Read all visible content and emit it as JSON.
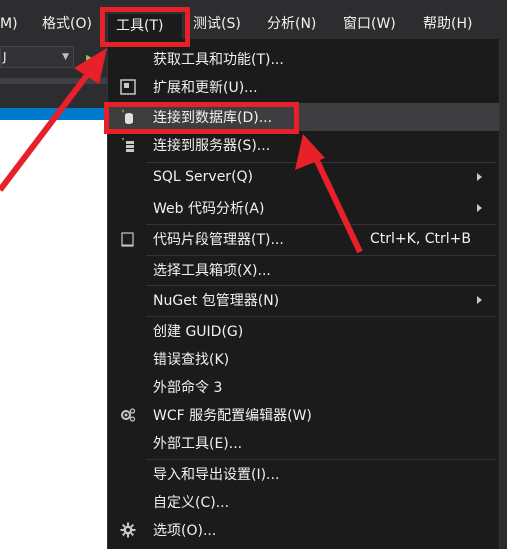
{
  "menubar": {
    "items": [
      {
        "label": "M)"
      },
      {
        "label": "格式(O)"
      },
      {
        "label": "工具(T)"
      },
      {
        "label": "测试(S)"
      },
      {
        "label": "分析(N)"
      },
      {
        "label": "窗口(W)"
      },
      {
        "label": "帮助(H)"
      }
    ]
  },
  "toolbar": {
    "config_value": "J",
    "start_icon": "play-icon"
  },
  "tools_menu": {
    "items": [
      {
        "label": "获取工具和功能(T)...",
        "icon": "none"
      },
      {
        "label": "扩展和更新(U)...",
        "icon": "extensions-icon"
      },
      {
        "label": "连接到数据库(D)...",
        "icon": "database-connect-icon"
      },
      {
        "label": "连接到服务器(S)...",
        "icon": "server-connect-icon"
      },
      {
        "label": "SQL Server(Q)",
        "icon": "none",
        "submenu": true
      },
      {
        "label": "Web 代码分析(A)",
        "icon": "none",
        "submenu": true
      },
      {
        "label": "代码片段管理器(T)...",
        "shortcut": "Ctrl+K, Ctrl+B",
        "icon": "snippet-icon"
      },
      {
        "label": "选择工具箱项(X)...",
        "icon": "none"
      },
      {
        "label": "NuGet 包管理器(N)",
        "icon": "none",
        "submenu": true
      },
      {
        "label": "创建 GUID(G)",
        "icon": "none"
      },
      {
        "label": "错误查找(K)",
        "icon": "none"
      },
      {
        "label": "外部命令 3",
        "icon": "none"
      },
      {
        "label": "WCF 服务配置编辑器(W)",
        "icon": "wcf-config-icon"
      },
      {
        "label": "外部工具(E)...",
        "icon": "none"
      },
      {
        "label": "导入和导出设置(I)...",
        "icon": "none"
      },
      {
        "label": "自定义(C)...",
        "icon": "none"
      },
      {
        "label": "选项(O)...",
        "icon": "gear-icon"
      }
    ]
  },
  "colors": {
    "background": "#2d2d30",
    "menu_background": "#1b1b1c",
    "hover": "#3e3e40",
    "highlight_red": "#e8202a",
    "accent_blue": "#007acc"
  }
}
